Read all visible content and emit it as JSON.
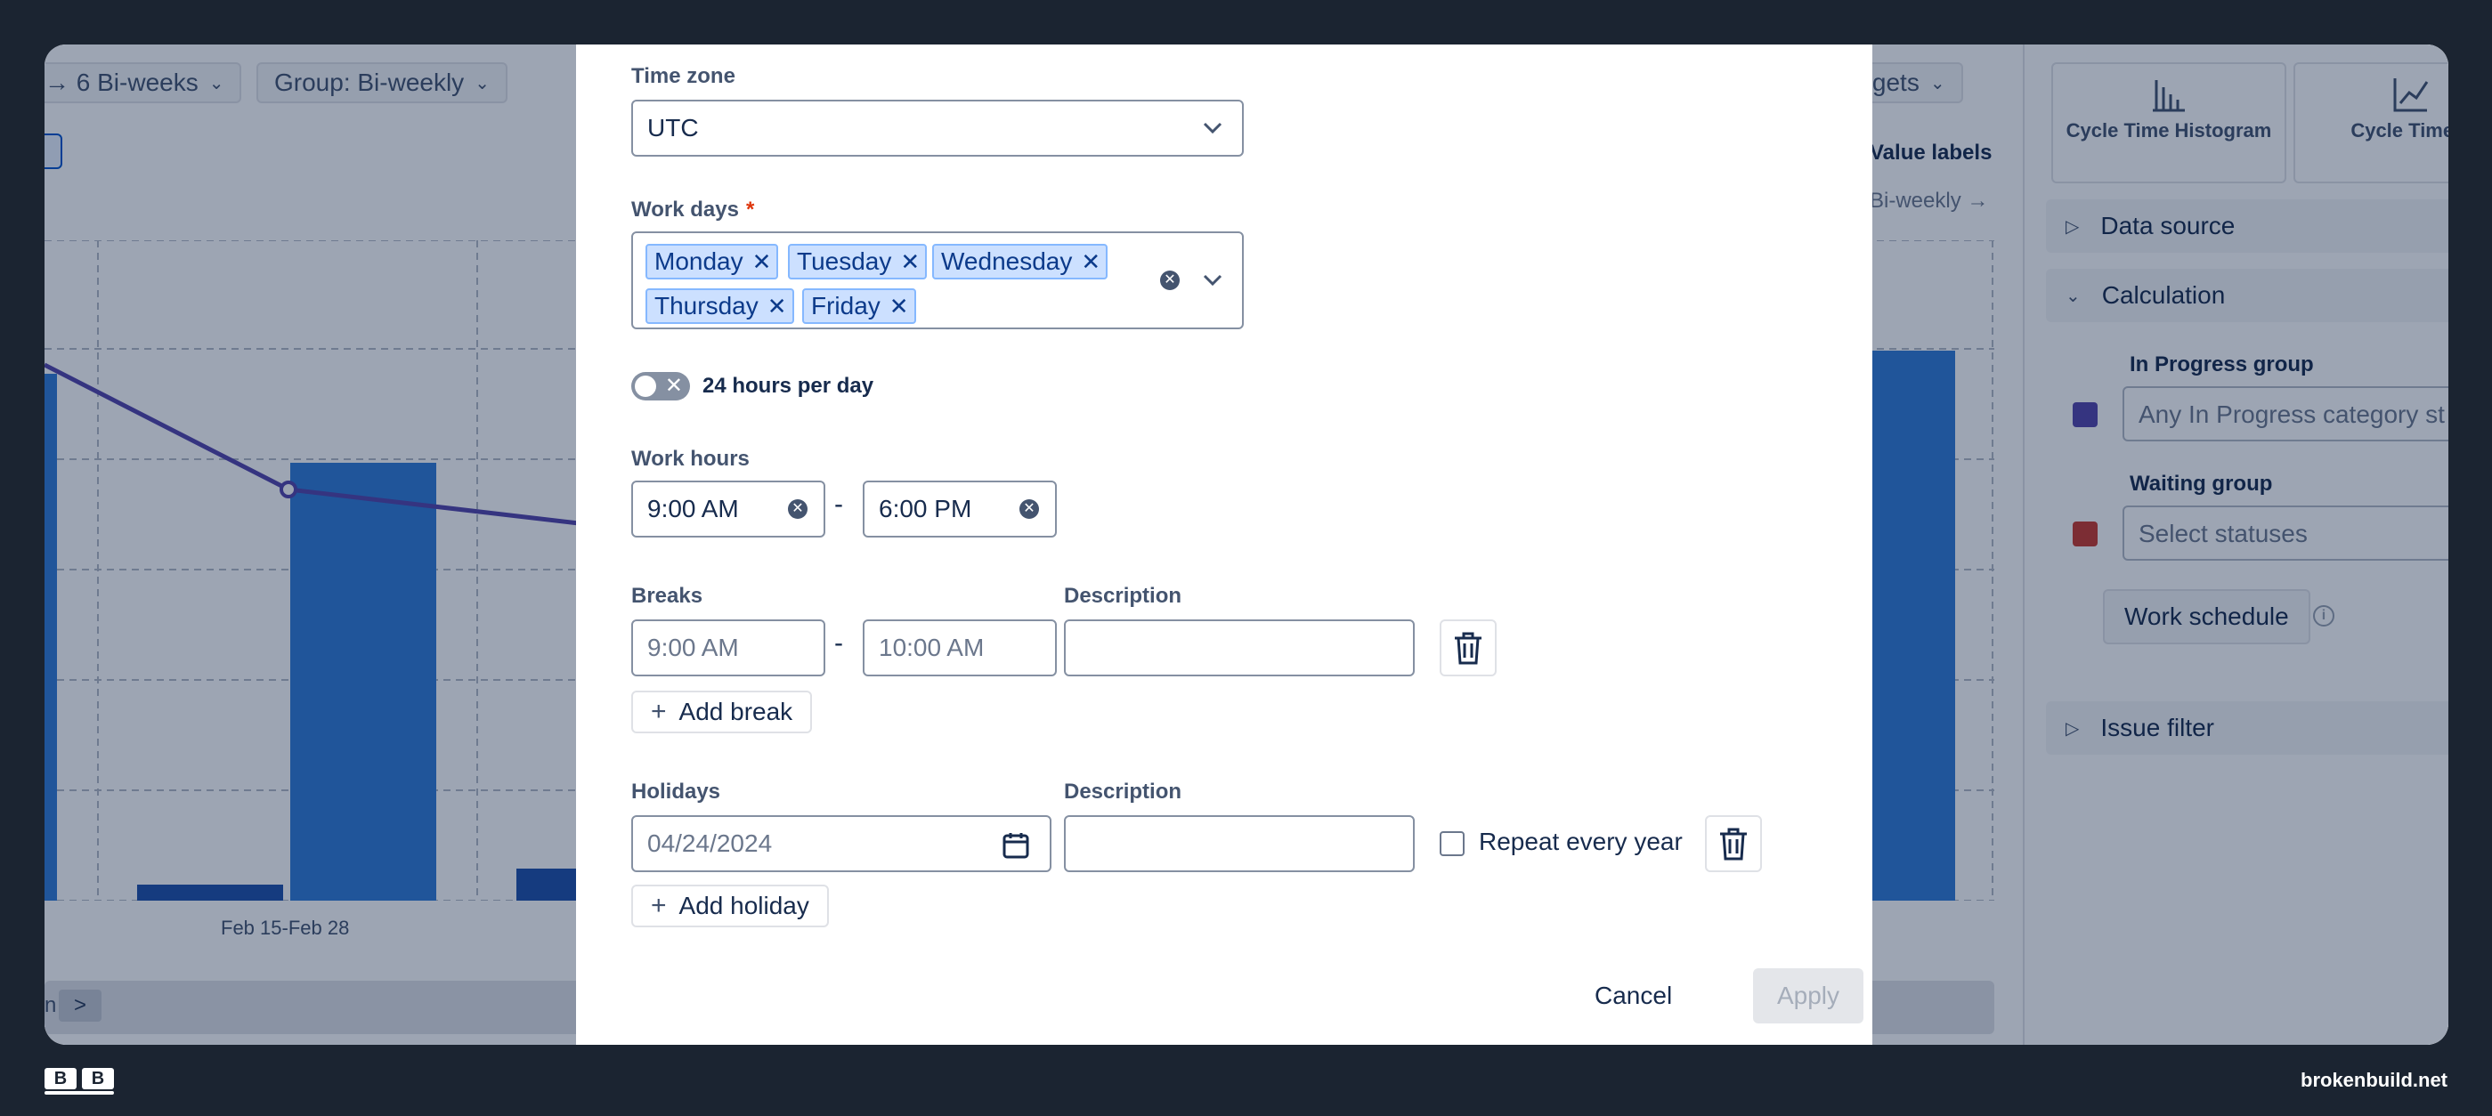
{
  "background": {
    "toolbar": {
      "range_label": "→ 6 Bi-weeks",
      "group_label": "Group: Bi-weekly",
      "targets_label": "argets"
    },
    "value_labels": "Value labels",
    "bi_weekly_link": "Bi-weekly →",
    "chart_x_label": "Feb 15-Feb 28",
    "bottom_tail": "n",
    "bottom_arrow": ">",
    "right_panel": {
      "chart_types": [
        "Cycle Time Histogram",
        "Cycle Time T"
      ],
      "sections": {
        "data_source": "Data source",
        "calculation": "Calculation",
        "issue_filter": "Issue filter"
      },
      "in_progress_group": {
        "label": "In Progress group",
        "value": "Any In Progress category st",
        "color": "#5243aa"
      },
      "waiting_group": {
        "label": "Waiting group",
        "placeholder": "Select statuses",
        "color": "#c9372c"
      },
      "work_schedule_button": "Work schedule"
    }
  },
  "modal": {
    "time_zone": {
      "label": "Time zone",
      "value": "UTC"
    },
    "work_days": {
      "label": "Work days",
      "required_marker": "*",
      "tags": [
        "Monday",
        "Tuesday",
        "Wednesday",
        "Thursday",
        "Friday"
      ]
    },
    "hours_per_day_toggle": {
      "label": "24 hours per day",
      "enabled": false
    },
    "work_hours": {
      "label": "Work hours",
      "start": "9:00 AM",
      "end": "6:00 PM",
      "separator": "-"
    },
    "breaks": {
      "label": "Breaks",
      "description_label": "Description",
      "start_placeholder": "9:00 AM",
      "end_placeholder": "10:00 AM",
      "separator": "-",
      "add_label": "Add break"
    },
    "holidays": {
      "label": "Holidays",
      "description_label": "Description",
      "date_placeholder": "04/24/2024",
      "repeat_label": "Repeat every year",
      "add_label": "Add holiday"
    },
    "footer": {
      "cancel_label": "Cancel",
      "apply_label": "Apply"
    }
  },
  "page_footer": {
    "logo_letters": [
      "B",
      "B"
    ],
    "site": "brokenbuild.net"
  },
  "colors": {
    "backdrop": "#1b2431",
    "bar": "#2f7bd6",
    "bar_dark": "#1d4fa8",
    "line": "#5243aa",
    "tag_bg": "#cce0ff"
  }
}
